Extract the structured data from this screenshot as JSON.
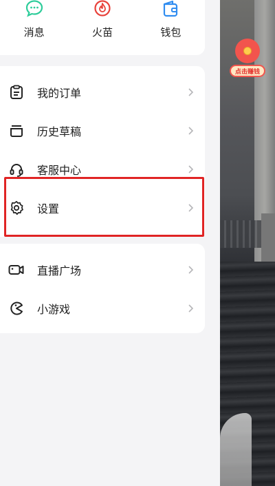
{
  "quick_actions": [
    {
      "label": "消息",
      "icon": "chat-bubble-icon",
      "color": "#2ecc9a"
    },
    {
      "label": "火苗",
      "icon": "flame-icon",
      "color": "#e8423b"
    },
    {
      "label": "钱包",
      "icon": "wallet-icon",
      "color": "#2f8cf0"
    }
  ],
  "menu_group_1": [
    {
      "label": "我的订单",
      "icon": "clipboard-icon"
    },
    {
      "label": "历史草稿",
      "icon": "drafts-tray-icon"
    },
    {
      "label": "客服中心",
      "icon": "headset-icon"
    },
    {
      "label": "设置",
      "icon": "gear-icon"
    }
  ],
  "menu_group_2": [
    {
      "label": "直播广场",
      "icon": "video-camera-icon"
    },
    {
      "label": "小游戏",
      "icon": "game-pacman-icon"
    }
  ],
  "floating_badge": {
    "label": "点击赚钱",
    "icon": "red-packet-icon"
  },
  "colors": {
    "highlight": "#e02424",
    "background": "#f4f4f6"
  }
}
